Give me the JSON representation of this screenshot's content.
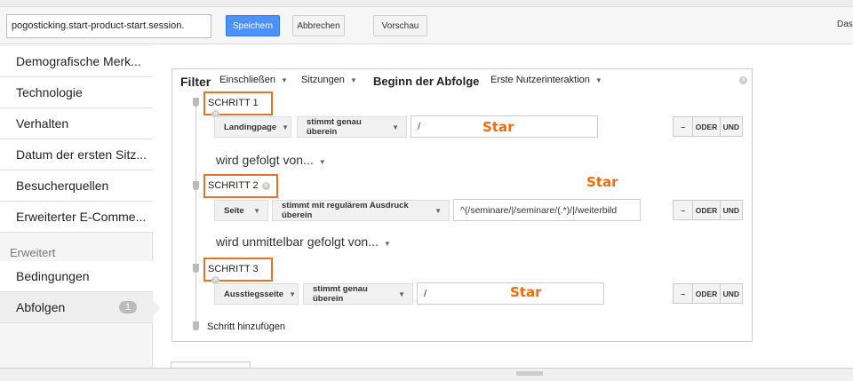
{
  "toolbar": {
    "segment_name": "pogosticking.start-product-start.session.",
    "save": "Speichern",
    "cancel": "Abbrechen",
    "preview": "Vorschau",
    "right_text": "Das"
  },
  "sidebar": {
    "items": [
      {
        "label": "Demografische Merk..."
      },
      {
        "label": "Technologie"
      },
      {
        "label": "Verhalten"
      },
      {
        "label": "Datum der ersten Sitz..."
      },
      {
        "label": "Besucherquellen"
      },
      {
        "label": "Erweiterter E-Comme..."
      }
    ],
    "section": "Erweitert",
    "advanced": [
      {
        "label": "Bedingungen"
      },
      {
        "label": "Abfolgen",
        "badge": "1",
        "selected": true
      }
    ]
  },
  "filter": {
    "title": "Filter",
    "include": "Einschließen",
    "scope": "Sitzungen",
    "sequence_start_label": "Beginn der Abfolge",
    "sequence_start": "Erste Nutzerinteraktion",
    "steps": [
      {
        "label": "SCHRITT 1",
        "dimension": "Landingpage",
        "operator": "stimmt genau überein",
        "value": "/",
        "annotation": "Star"
      },
      {
        "label": "SCHRITT 2",
        "dimension": "Seite",
        "operator": "stimmt mit regulärem Ausdruck überein",
        "value": "^(/seminare/|/seminare/(.*)/|/weiterbild",
        "annotation": "Star"
      },
      {
        "label": "SCHRITT 3",
        "dimension": "Ausstiegsseite",
        "operator": "stimmt genau überein",
        "value": "/",
        "annotation": "Star"
      }
    ],
    "connectors": [
      "wird gefolgt von...",
      "wird unmittelbar gefolgt von..."
    ],
    "remove": "–",
    "or": "ODER",
    "and": "UND",
    "add_step": "Schritt hinzufügen"
  },
  "colors": {
    "accent": "#4d90fe",
    "highlight": "#e8712a",
    "annotation": "#f26b0f"
  }
}
